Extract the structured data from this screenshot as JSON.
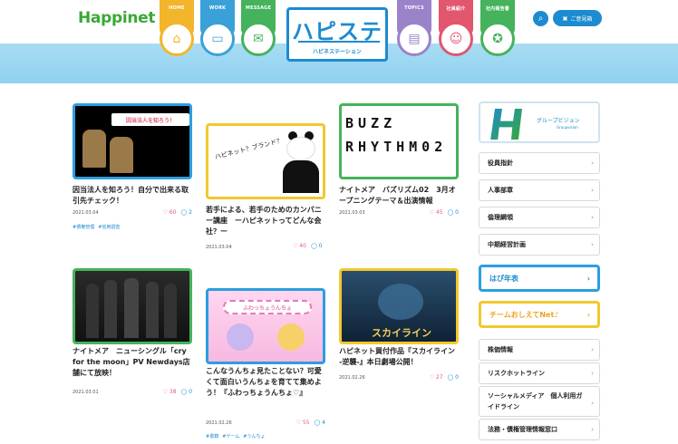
{
  "header": {
    "logo": "Happinet",
    "brand_title": "ハピステ",
    "brand_subtitle": "ハピネステーション",
    "nav_left": [
      {
        "label": "HOME",
        "icon": "house-icon",
        "color": "#f3b52a"
      },
      {
        "label": "WORK",
        "icon": "laptop-icon",
        "color": "#3aa1d8"
      },
      {
        "label": "MESSAGE",
        "icon": "speech-icon",
        "color": "#45b25c"
      }
    ],
    "nav_right": [
      {
        "label": "TOPICS",
        "icon": "newspaper-icon",
        "color": "#9a83c8"
      },
      {
        "label": "社員紹介",
        "icon": "people-icon",
        "color": "#e2566e"
      },
      {
        "label": "社内報告書",
        "icon": "bulb-icon",
        "color": "#45b25c"
      }
    ],
    "login_label": "ご意見箱"
  },
  "articles": [
    {
      "title": "因当法人を知ろう！自分で出来る取引先チェック！",
      "date": "2021.03.04",
      "likes": "60",
      "comments": "2",
      "tags": [
        "#債権管理",
        "#信用調査"
      ],
      "border_color": "#2c9ee0",
      "thumb_text": "因当法人を知ろう！"
    },
    {
      "title": "若手による、若手のためのカンパニー講座　ーハピネットってどんな会社？ー",
      "date": "2021.03.04",
      "likes": "40",
      "comments": "0",
      "tags": [],
      "border_color": "#f2c82f",
      "thumb_text": "ハピネット？ブランド？"
    },
    {
      "title": "ナイトメア　バズリズム02　3月オープニングテーマ＆出演情報",
      "date": "2021.03.03",
      "likes": "45",
      "comments": "0",
      "tags": [],
      "border_color": "#46b35a",
      "thumb_text": "BUZZ RHYTHM02"
    },
    {
      "title": "ナイトメア　ニューシングル「cry for the moon」PV Newdays店舗にて放映！",
      "date": "2021.03.01",
      "likes": "38",
      "comments": "0",
      "tags": [],
      "border_color": "#46b35a",
      "thumb_text": ""
    },
    {
      "title": "こんなうんちょ見たことない？可愛くて面白いうんちょを育てて集めよう！『ふわっちょうんちょ♡』",
      "date": "2021.02.26",
      "likes": "55",
      "comments": "4",
      "tags": [
        "#書籍",
        "#ゲーム",
        "#うんちょ"
      ],
      "border_color": "#2c9ee0",
      "thumb_text": "ふわっちょうんちょ"
    },
    {
      "title": "ハピネット買付作品『スカイライン -逆襲-』本日劇場公開！",
      "date": "2021.02.26",
      "likes": "27",
      "comments": "0",
      "tags": [],
      "border_color": "#f2c82f",
      "thumb_text": "スカイライン"
    }
  ],
  "sidebar": {
    "banner_title": "グループビジョン",
    "banner_sub": "Groupvision",
    "items_top": [
      "役員指針",
      "人事部章",
      "倫理綱領",
      "中期経営計画"
    ],
    "big": [
      {
        "label": "はぴ年表",
        "color": "#2c9ee0",
        "text_color": "#1d8bd0"
      },
      {
        "label": "チームおしえてNet♪",
        "color": "#f2c82f",
        "text_color": "#f0a21e"
      }
    ],
    "items_bottom": [
      "株価情報",
      "リスクホットライン",
      "ソーシャルメディア　個人利用ガイドライン",
      "法務・債権管理情報窓口"
    ]
  }
}
